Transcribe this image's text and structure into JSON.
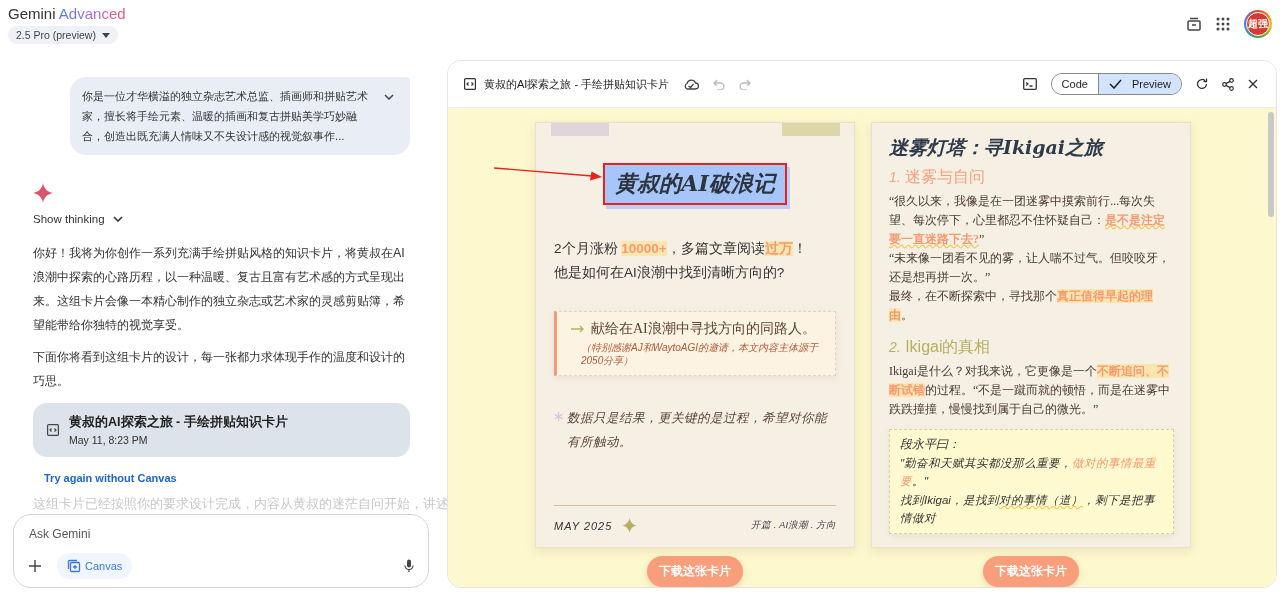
{
  "header": {
    "brand": "Gemini",
    "tier": "Advanced",
    "model": "2.5 Pro (preview)",
    "avatar": "超强"
  },
  "chat": {
    "user_message": "你是一位才华横溢的独立杂志艺术总监、插画师和拼贴艺术家，擅长将手绘元素、温暖的插画和复古拼贴美学巧妙融合，创造出既充满人情味又不失设计感的视觉叙事作...",
    "expanded": false,
    "show_thinking": "Show thinking",
    "paragraphs": [
      "你好！我将为你创作一系列充满手绘拼贴风格的知识卡片，将黄叔在AI浪潮中探索的心路历程，以一种温暖、复古且富有艺术感的方式呈现出来。这组卡片会像一本精心制作的独立杂志或艺术家的灵感剪贴簿，希望能带给你独特的视觉享受。",
      "下面你将看到这组卡片的设计，每一张都力求体现手作的温度和设计的巧思。"
    ],
    "artifact": {
      "title": "黄叔的AI探索之旅 - 手绘拼贴知识卡片",
      "time": "May 11, 8:23 PM"
    },
    "retry_link": "Try again without Canvas",
    "faded_text": "这组卡片已经按照你的要求设计完成，内容从黄叔的迷茫自问开始，讲述"
  },
  "composer": {
    "placeholder": "Ask Gemini",
    "tool": "Canvas"
  },
  "canvas": {
    "title": "黄叔的AI探索之旅 - 手绘拼贴知识卡片",
    "undo_disabled": true,
    "redo_disabled": true,
    "view_tabs": [
      {
        "label": "Code",
        "selected": false
      },
      {
        "label": "Preview",
        "selected": true
      }
    ],
    "cards": [
      {
        "kind": "cover",
        "title": "黄叔的AI破浪记",
        "marked": true,
        "lead": [
          [
            {
              "text": "2个月涨粉 ",
              "kind": "plain"
            },
            {
              "text": "10000+",
              "kind": "mark"
            },
            {
              "text": "，多篇文章阅读",
              "kind": "plain"
            },
            {
              "text": "过万",
              "kind": "mark"
            },
            {
              "text": "！",
              "kind": "plain"
            }
          ],
          [
            {
              "text": "他是如何在AI浪潮中找到清晰方向的?",
              "kind": "plain"
            }
          ]
        ],
        "dedication": "献给在AI浪潮中寻找方向的同路人。",
        "note": "（特别感谢AJ和WaytoAGI的邀请，本文内容主体源于2050分享）",
        "closing": "数据只是结果，更关键的是过程，希望对你能有所触动。",
        "date": "MAY 2025",
        "tags": "开篇 . AI浪潮 . 方向",
        "download": "下载这张卡片"
      },
      {
        "kind": "chapter",
        "title": "迷雾灯塔：寻Ikigai之旅",
        "sections": [
          {
            "number": "1.",
            "heading": "迷雾与自问",
            "color": "#f4a07c",
            "paragraphs": [
              [
                {
                  "text": "“很久以来，我像是在一团迷雾中摸索前行...每次失望、每次停下，心里都忍不住怀疑自己：",
                  "kind": "plain"
                },
                {
                  "text": "是不是注定要一直迷路下去?",
                  "kind": "wave"
                },
                {
                  "text": "”",
                  "kind": "plain"
                }
              ],
              [
                {
                  "text": "“未来像一团看不见的雾，让人喘不过气。但咬咬牙，还是想再拼一次。”",
                  "kind": "plain"
                }
              ],
              [
                {
                  "text": "最终，在不断探索中，寻找那个",
                  "kind": "plain"
                },
                {
                  "text": "真正值得早起的理由",
                  "kind": "mark"
                },
                {
                  "text": "。",
                  "kind": "plain"
                }
              ]
            ]
          },
          {
            "number": "2.",
            "heading": "Ikigai的真相",
            "color": "#b8b060",
            "paragraphs": [
              [
                {
                  "text": "Ikigai是什么？对我来说，它更像是一个",
                  "kind": "plain"
                },
                {
                  "text": "不断追问、不断试错",
                  "kind": "mark"
                },
                {
                  "text": "的过程。“不是一蹴而就的顿悟，而是在迷雾中跌跌撞撞，慢慢找到属于自己的微光。”",
                  "kind": "plain"
                }
              ]
            ]
          }
        ],
        "quote": {
          "author": "段永平曰：",
          "lines": [
            [
              {
                "text": "\"勤奋和天赋其实都没那么重要，",
                "kind": "plain"
              },
              {
                "text": "做对的事情最重要",
                "kind": "orange"
              },
              {
                "text": "。\"",
                "kind": "plain"
              }
            ],
            [
              {
                "text": "找到Ikigai，是找到",
                "kind": "plain"
              },
              {
                "text": "对的事情（道）",
                "kind": "under"
              },
              {
                "text": "，剩下是把事情做对",
                "kind": "plain"
              }
            ]
          ]
        },
        "download": "下载这张卡片"
      }
    ]
  }
}
